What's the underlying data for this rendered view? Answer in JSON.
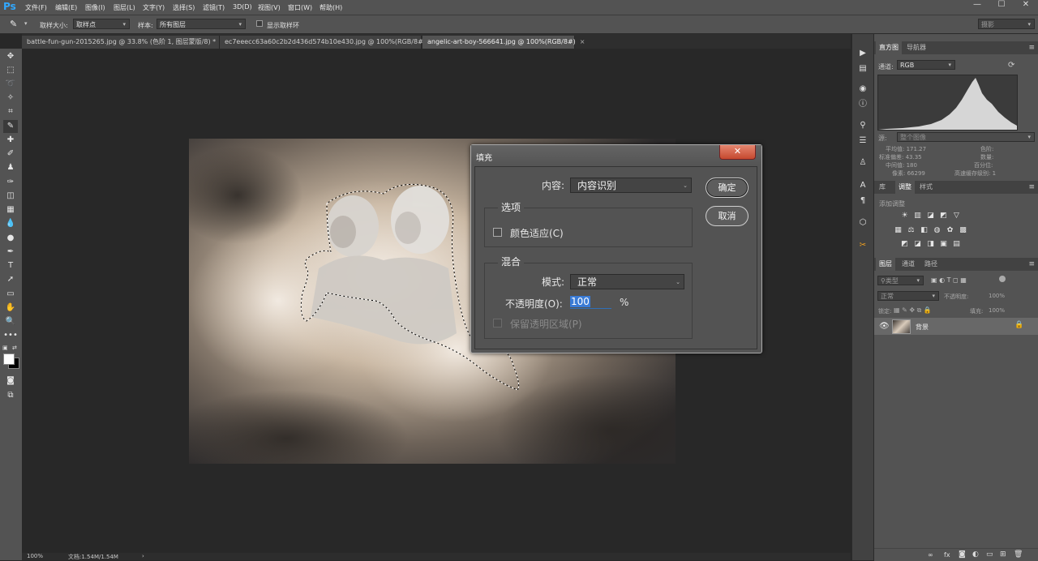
{
  "app": {
    "logo": "Ps"
  },
  "menu": [
    "文件(F)",
    "编辑(E)",
    "图像(I)",
    "图层(L)",
    "文字(Y)",
    "选择(S)",
    "滤镜(T)",
    "3D(D)",
    "视图(V)",
    "窗口(W)",
    "帮助(H)"
  ],
  "window_controls": {
    "minimize": "—",
    "maximize": "☐",
    "close": "✕"
  },
  "options_bar": {
    "sample_size_label": "取样大小:",
    "sample_size_value": "取样点",
    "sample_label": "样本:",
    "sample_value": "所有图层",
    "show_ring_label": "显示取样环",
    "workspace_value": "摄影"
  },
  "doc_tabs": [
    {
      "label": "battle-fun-gun-2015265.jpg @ 33.8% (色阶 1, 图层蒙版/8) *",
      "close": "×"
    },
    {
      "label": "ec7eeecc63a60c2b2d436d574b10e430.jpg @ 100%(RGB/8#) *",
      "close": "×"
    },
    {
      "label": "angelic-art-boy-566641.jpg @ 100%(RGB/8#)",
      "close": "×"
    }
  ],
  "status": {
    "zoom": "100%",
    "doc": "文档:1.54M/1.54M",
    "arrow": "›"
  },
  "histogram_panel": {
    "tabs": [
      "直方图",
      "导航器"
    ],
    "channel_label": "通道:",
    "channel_value": "RGB",
    "source_label": "源:",
    "source_value": "整个图像",
    "stats_left": [
      {
        "label": "平均值:",
        "value": "171.27"
      },
      {
        "label": "标准偏差:",
        "value": "43.35"
      },
      {
        "label": "中间值:",
        "value": "180"
      },
      {
        "label": "像素:",
        "value": "66299"
      }
    ],
    "stats_right": [
      {
        "label": "色阶:",
        "value": ""
      },
      {
        "label": "数量:",
        "value": ""
      },
      {
        "label": "百分位:",
        "value": ""
      },
      {
        "label": "高速缓存级别:",
        "value": "1"
      }
    ]
  },
  "adjustments_panel": {
    "tabs": [
      "库",
      "调整",
      "样式"
    ],
    "heading": "添加调整"
  },
  "layers_panel": {
    "tabs": [
      "图层",
      "通道",
      "路径"
    ],
    "filter_value": "类型",
    "blend_value": "正常",
    "opacity_label": "不透明度:",
    "opacity_value": "100%",
    "lock_label": "锁定:",
    "fill_label": "填充:",
    "fill_value": "100%",
    "layers": [
      {
        "name": "背景",
        "visible": true,
        "locked": true
      }
    ],
    "footer_icons": [
      "link-icon",
      "fx-icon",
      "mask-icon",
      "adjustment-icon",
      "group-icon",
      "new-layer-icon",
      "trash-icon"
    ]
  },
  "fill_dialog": {
    "title": "填充",
    "close": "✕",
    "content_label": "内容:",
    "content_value": "内容识别",
    "options_title": "选项",
    "color_adapt_label": "颜色适应(C)",
    "color_adapt_checked": false,
    "blend_title": "混合",
    "mode_label": "模式:",
    "mode_value": "正常",
    "opacity_label": "不透明度(O):",
    "opacity_value": "100",
    "opacity_unit": "%",
    "preserve_label": "保留透明区域(P)",
    "preserve_checked": false,
    "ok": "确定",
    "cancel": "取消"
  },
  "colors": {
    "accent": "#31a8ff",
    "ui_dark": "#535353",
    "canvas_bg": "#282828",
    "selected_text_bg": "#3a7bd5"
  }
}
